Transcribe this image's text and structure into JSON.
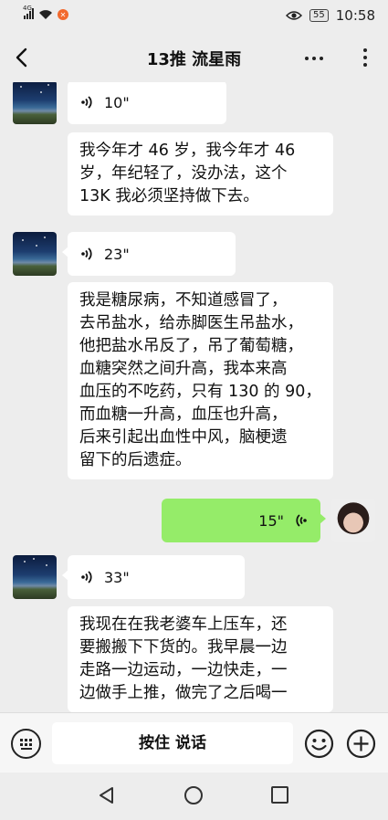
{
  "status_bar": {
    "signal": "4G",
    "time": "10:58",
    "battery": "55",
    "icons": [
      "signal-icon",
      "wifi-icon",
      "mute-icon",
      "eye-icon",
      "battery-icon"
    ]
  },
  "header": {
    "title": "13推  流星雨"
  },
  "messages": [
    {
      "type": "voice",
      "side": "left",
      "duration": "10\""
    },
    {
      "type": "text",
      "side": "left",
      "lines": [
        "我今年才 46 岁，我今年才 46",
        "岁，年纪轻了，没办法，这个",
        "13K 我必须坚持做下去。"
      ]
    },
    {
      "type": "voice",
      "side": "left",
      "duration": "23\""
    },
    {
      "type": "text",
      "side": "left",
      "lines": [
        "我是糖尿病，不知道感冒了，",
        "去吊盐水，给赤脚医生吊盐水，",
        "他把盐水吊反了，吊了葡萄糖，",
        "血糖突然之间升高，我本来高",
        "血压的不吃药，只有 130 的 90，",
        "而血糖一升高，血压也升高，",
        "后来引起出血性中风，脑梗遗",
        "留下的后遗症。"
      ]
    },
    {
      "type": "voice",
      "side": "right",
      "duration": "15\""
    },
    {
      "type": "voice",
      "side": "left",
      "duration": "33\""
    },
    {
      "type": "text",
      "side": "left",
      "lines": [
        "我现在在我老婆车上压车，还",
        "要搬搬下下货的。我早晨一边",
        "走路一边运动，一边快走，一",
        "边做手上推，做完了之后喝一"
      ]
    }
  ],
  "input_bar": {
    "hold_to_talk": "按住 说话"
  },
  "colors": {
    "background": "#ededed",
    "my_bubble": "#95ec69",
    "other_bubble": "#ffffff"
  }
}
